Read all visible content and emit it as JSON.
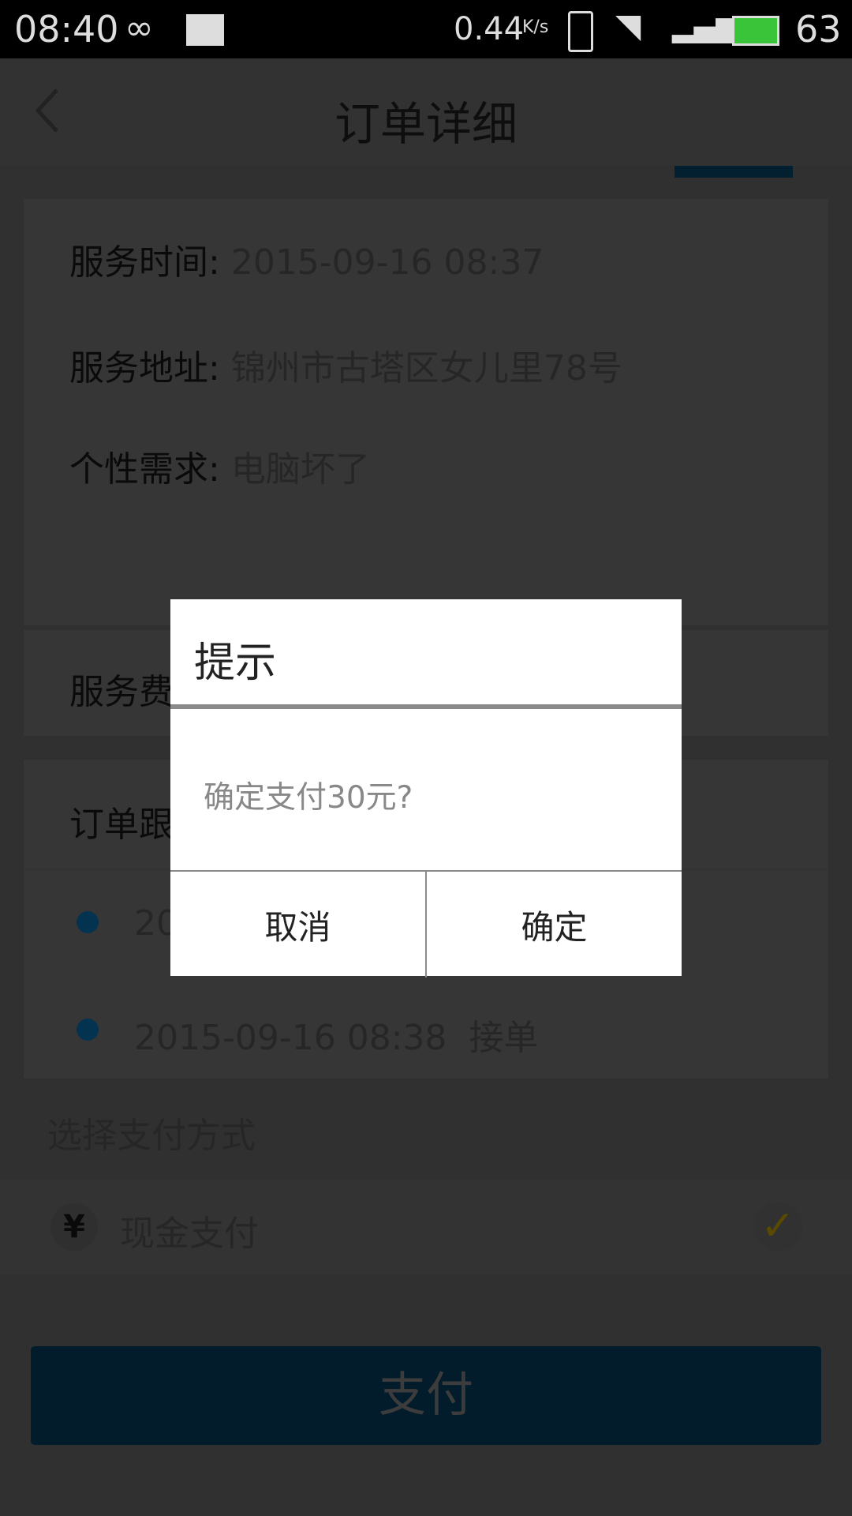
{
  "status_bar": {
    "time": "08:40",
    "speed": "0.44",
    "speed_unit": "K/s",
    "battery": "63"
  },
  "header": {
    "title": "订单详细"
  },
  "details": [
    {
      "label": "服务时间:",
      "value": "2015-09-16 08:37"
    },
    {
      "label": "服务地址:",
      "value": "锦州市古塔区女儿里78号"
    },
    {
      "label": "个性需求:",
      "value": "电脑坏了"
    }
  ],
  "fee": {
    "label": "服务费"
  },
  "tracking": {
    "label": "订单跟",
    "items": [
      {
        "time": "20",
        "text": ""
      },
      {
        "time": "2015-09-16 08:38",
        "text": "接单"
      }
    ]
  },
  "payment": {
    "section_label": "选择支付方式",
    "method": "现金支付",
    "selected": true
  },
  "pay_button": "支付",
  "dialog": {
    "title": "提示",
    "message": "确定支付30元?",
    "cancel": "取消",
    "confirm": "确定"
  },
  "colors": {
    "accent": "#0c5a8e",
    "check": "#f0c000"
  }
}
